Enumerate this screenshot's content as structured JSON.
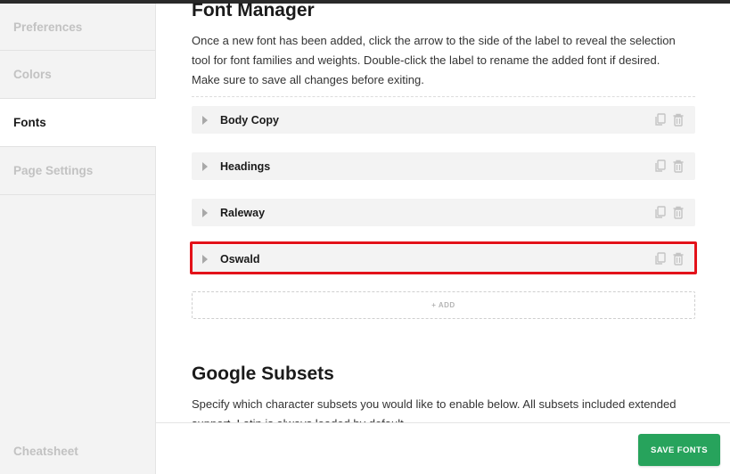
{
  "sidebar": {
    "items": [
      {
        "label": "Preferences",
        "active": false
      },
      {
        "label": "Colors",
        "active": false
      },
      {
        "label": "Fonts",
        "active": true
      },
      {
        "label": "Page Settings",
        "active": false
      }
    ],
    "bottom_link": "Cheatsheet"
  },
  "font_manager": {
    "title": "Font Manager",
    "description": "Once a new font has been added, click the arrow to the side of the label to reveal the selection tool for font families and weights. Double-click the label to rename the added font if desired. Make sure to save all changes before exiting.",
    "fonts": [
      {
        "label": "Body Copy"
      },
      {
        "label": "Headings"
      },
      {
        "label": "Raleway"
      },
      {
        "label": "Oswald",
        "highlighted": true
      }
    ],
    "add_label": "+ ADD"
  },
  "google_subsets": {
    "title": "Google Subsets",
    "description": "Specify which character subsets you would like to enable below. All subsets included extended support. Latin is always loaded by default."
  },
  "footer": {
    "save_label": "SAVE FONTS"
  },
  "colors": {
    "accent": "#27a35c",
    "highlight": "#e3121a"
  }
}
